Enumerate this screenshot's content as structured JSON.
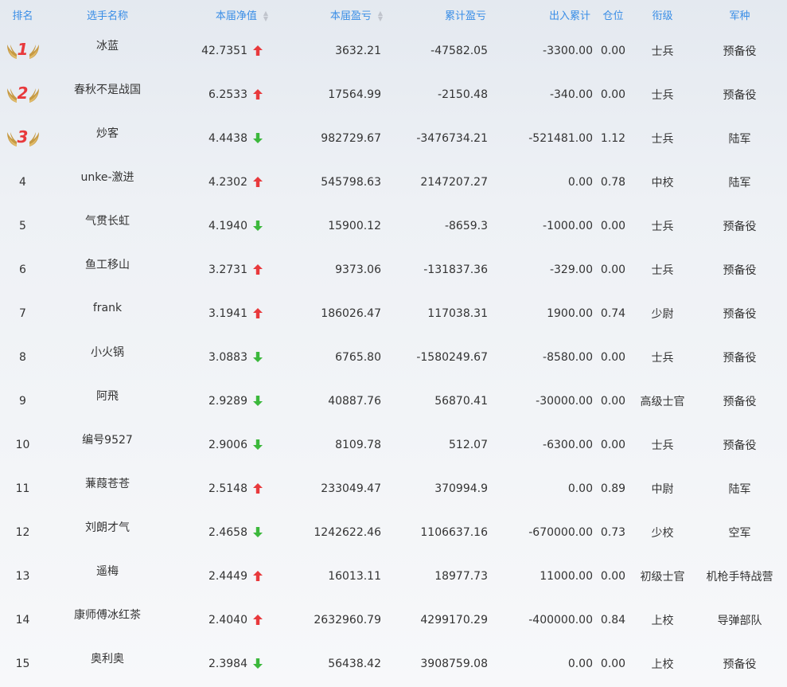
{
  "headers": {
    "rank": "排名",
    "name": "选手名称",
    "nav": "本届净值",
    "profit": "本届盈亏",
    "total": "累计盈亏",
    "flow": "出入累计",
    "position": "仓位",
    "title": "衔级",
    "branch": "军种"
  },
  "colors": {
    "up": "#e8393c",
    "down": "#3cb83c",
    "header": "#3a8ee6",
    "medal": "#e8393c"
  },
  "rows": [
    {
      "rank": "1",
      "medal": true,
      "name": "冰蓝",
      "nav": "42.7351",
      "trend": "up",
      "profit": "3632.21",
      "total": "-47582.05",
      "flow": "-3300.00",
      "position": "0.00",
      "title": "士兵",
      "branch": "预备役"
    },
    {
      "rank": "2",
      "medal": true,
      "name": "春秋不是战国",
      "nav": "6.2533",
      "trend": "up",
      "profit": "17564.99",
      "total": "-2150.48",
      "flow": "-340.00",
      "position": "0.00",
      "title": "士兵",
      "branch": "预备役"
    },
    {
      "rank": "3",
      "medal": true,
      "name": "炒客",
      "nav": "4.4438",
      "trend": "down",
      "profit": "982729.67",
      "total": "-3476734.21",
      "flow": "-521481.00",
      "position": "1.12",
      "title": "士兵",
      "branch": "陆军"
    },
    {
      "rank": "4",
      "medal": false,
      "name": "unke-激进",
      "nav": "4.2302",
      "trend": "up",
      "profit": "545798.63",
      "total": "2147207.27",
      "flow": "0.00",
      "position": "0.78",
      "title": "中校",
      "branch": "陆军"
    },
    {
      "rank": "5",
      "medal": false,
      "name": "气贯长虹",
      "nav": "4.1940",
      "trend": "down",
      "profit": "15900.12",
      "total": "-8659.3",
      "flow": "-1000.00",
      "position": "0.00",
      "title": "士兵",
      "branch": "预备役"
    },
    {
      "rank": "6",
      "medal": false,
      "name": "鱼工移山",
      "nav": "3.2731",
      "trend": "up",
      "profit": "9373.06",
      "total": "-131837.36",
      "flow": "-329.00",
      "position": "0.00",
      "title": "士兵",
      "branch": "预备役"
    },
    {
      "rank": "7",
      "medal": false,
      "name": "frank",
      "nav": "3.1941",
      "trend": "up",
      "profit": "186026.47",
      "total": "117038.31",
      "flow": "1900.00",
      "position": "0.74",
      "title": "少尉",
      "branch": "预备役"
    },
    {
      "rank": "8",
      "medal": false,
      "name": "小火锅",
      "nav": "3.0883",
      "trend": "down",
      "profit": "6765.80",
      "total": "-1580249.67",
      "flow": "-8580.00",
      "position": "0.00",
      "title": "士兵",
      "branch": "预备役"
    },
    {
      "rank": "9",
      "medal": false,
      "name": "阿飛",
      "nav": "2.9289",
      "trend": "down",
      "profit": "40887.76",
      "total": "56870.41",
      "flow": "-30000.00",
      "position": "0.00",
      "title": "高级士官",
      "branch": "预备役"
    },
    {
      "rank": "10",
      "medal": false,
      "name": "编号9527",
      "nav": "2.9006",
      "trend": "down",
      "profit": "8109.78",
      "total": "512.07",
      "flow": "-6300.00",
      "position": "0.00",
      "title": "士兵",
      "branch": "预备役"
    },
    {
      "rank": "11",
      "medal": false,
      "name": "蒹葭苍苍",
      "nav": "2.5148",
      "trend": "up",
      "profit": "233049.47",
      "total": "370994.9",
      "flow": "0.00",
      "position": "0.89",
      "title": "中尉",
      "branch": "陆军"
    },
    {
      "rank": "12",
      "medal": false,
      "name": "刘朗才气",
      "nav": "2.4658",
      "trend": "down",
      "profit": "1242622.46",
      "total": "1106637.16",
      "flow": "-670000.00",
      "position": "0.73",
      "title": "少校",
      "branch": "空军"
    },
    {
      "rank": "13",
      "medal": false,
      "name": "遥梅",
      "nav": "2.4449",
      "trend": "up",
      "profit": "16013.11",
      "total": "18977.73",
      "flow": "11000.00",
      "position": "0.00",
      "title": "初级士官",
      "branch": "机枪手特战营"
    },
    {
      "rank": "14",
      "medal": false,
      "name": "康师傅冰红茶",
      "nav": "2.4040",
      "trend": "up",
      "profit": "2632960.79",
      "total": "4299170.29",
      "flow": "-400000.00",
      "position": "0.84",
      "title": "上校",
      "branch": "导弹部队"
    },
    {
      "rank": "15",
      "medal": false,
      "name": "奥利奥",
      "nav": "2.3984",
      "trend": "down",
      "profit": "56438.42",
      "total": "3908759.08",
      "flow": "0.00",
      "position": "0.00",
      "title": "上校",
      "branch": "预备役"
    }
  ]
}
